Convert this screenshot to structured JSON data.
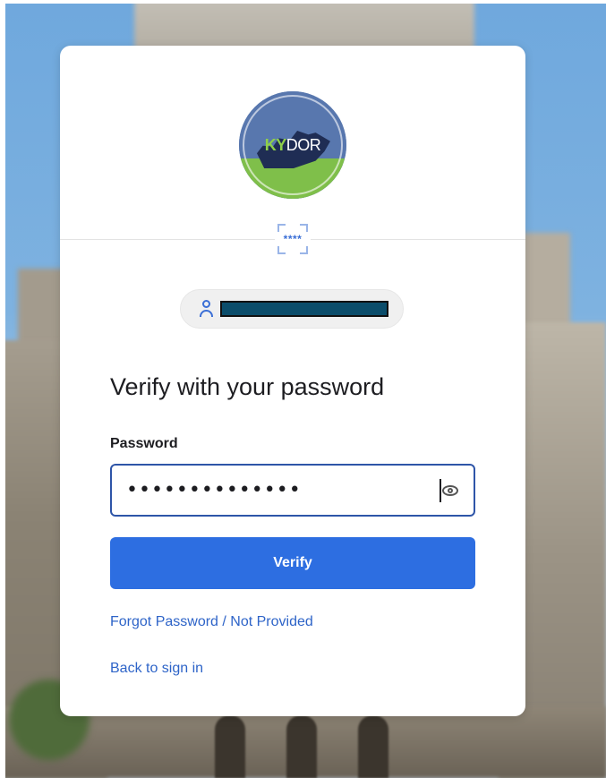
{
  "logo": {
    "ky": "KY",
    "dor": "DOR"
  },
  "factor_icon": {
    "mask": "****"
  },
  "user": {
    "icon": "user-icon",
    "identifier": ""
  },
  "form": {
    "heading": "Verify with your password",
    "password_label": "Password",
    "password_value": "••••••••••••••",
    "submit_label": "Verify",
    "forgot_link": "Forgot Password / Not Provided",
    "back_link": "Back to sign in"
  },
  "colors": {
    "primary": "#2d6ee1",
    "link": "#2e64c8",
    "input_border": "#2e55a8",
    "redaction": "#0b4d6b"
  }
}
